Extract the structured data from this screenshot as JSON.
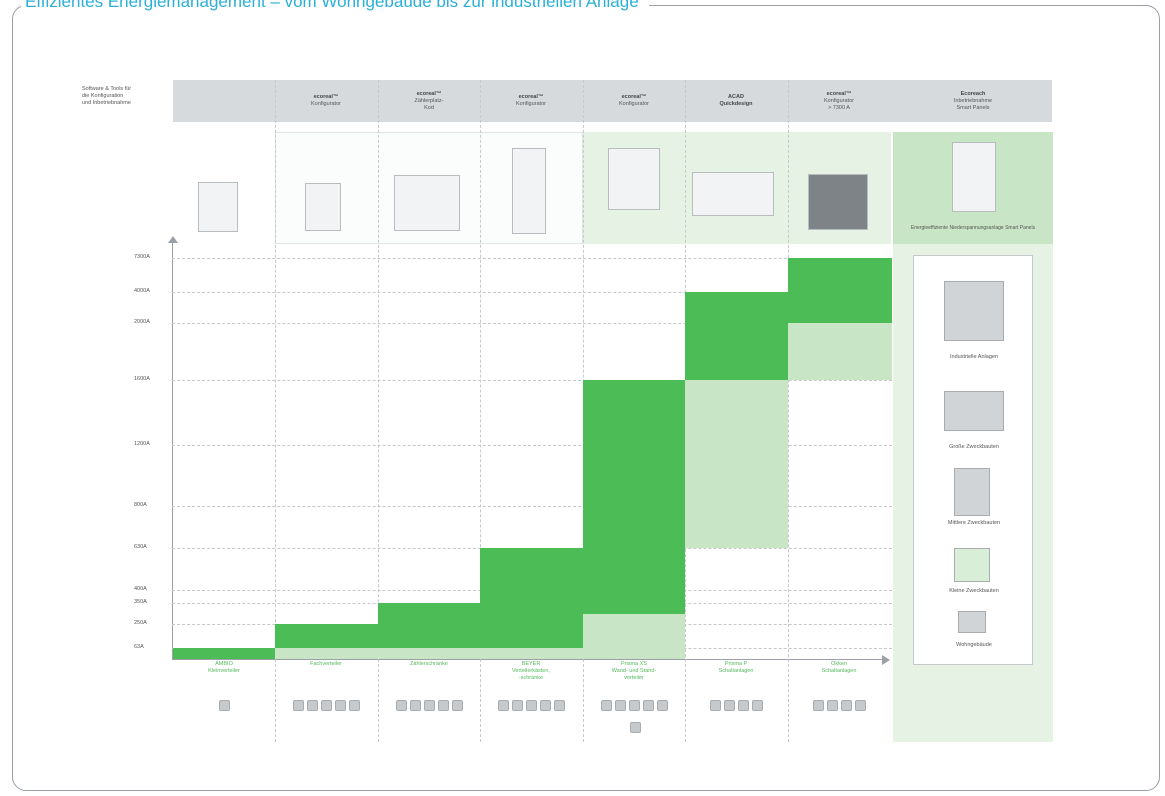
{
  "title": "Effizientes Energiemanagement – vom Wohngebäude bis zur industriellen Anlage",
  "header": {
    "left_label": [
      "Software & Tools für",
      "die Konfiguration",
      "und Inbetriebnahme"
    ],
    "columns": [
      {
        "line1": "",
        "line2": ""
      },
      {
        "line1": "ecoreal™",
        "line2": "Konfigurator"
      },
      {
        "line1": "ecoreal™",
        "line2": "Zählerplatz-",
        "line3": "Kod"
      },
      {
        "line1": "ecoreal™",
        "line2": "Konfigurator"
      },
      {
        "line1": "ecoreal™",
        "line2": "Konfigurator"
      },
      {
        "line1": "ACAD",
        "line2": "Quickdesign"
      },
      {
        "line1": "ecoreal™",
        "line2": "Konfigurator",
        "line3": "> 7300 A"
      },
      {
        "line1": "Ecoreach",
        "line2": "Inbetriebnahme",
        "line3": "Smart Panels"
      }
    ]
  },
  "last_product_caption": "Energieeffiziente Niederspannungsanlage Smart Panels",
  "y_axis": [
    "7300A",
    "4000A",
    "2000A",
    "1600A",
    "1200A",
    "800A",
    "630A",
    "400A",
    "350A",
    "250A",
    "63A"
  ],
  "categories": [
    {
      "line1": "AMBIO",
      "line2": "Kleinverteiler"
    },
    {
      "line1": "Fachverteiler",
      "line2": ""
    },
    {
      "line1": "Zählerschränke",
      "line2": ""
    },
    {
      "line1": "BEYER",
      "line2": "Verteilerkästen,",
      "line3": "-schränke"
    },
    {
      "line1": "Prisma XS",
      "line2": "Wand- und Stand-",
      "line3": "verteiler"
    },
    {
      "line1": "Prisma P",
      "line2": "Schaltanlagen"
    },
    {
      "line1": "Okken",
      "line2": "Schaltanlagen"
    }
  ],
  "legend": [
    "Industrielle Anlagen",
    "Große Zweckbauten",
    "Mittlere Zweckbauten",
    "Kleine Zweckbauten",
    "Wohngebäude"
  ],
  "colors": {
    "accent_title": "#2ab0d8",
    "green_dark": "#4cbc56",
    "green_light": "#c8e6c5",
    "green_pale": "#e6f3e4",
    "header_gray": "#d6dadd"
  }
}
